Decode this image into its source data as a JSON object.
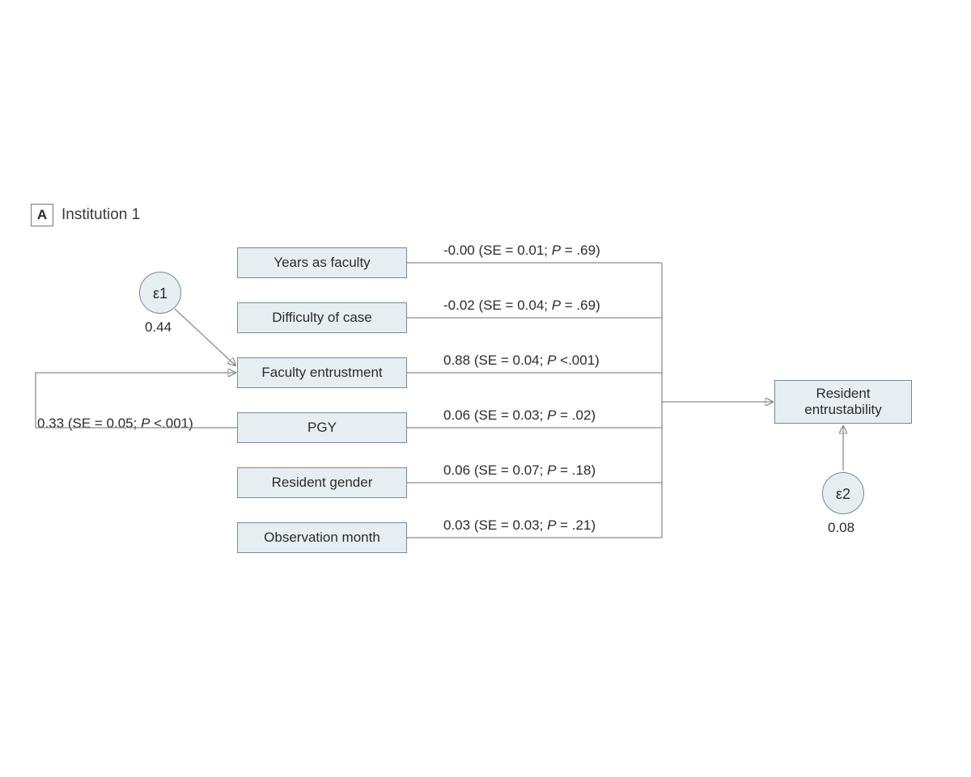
{
  "panel": {
    "letter": "A",
    "title": "Institution 1"
  },
  "predictors": {
    "years_faculty": {
      "label": "Years as faculty",
      "coef": "-0.00",
      "se": "0.01",
      "p": ".69"
    },
    "difficulty": {
      "label": "Difficulty of case",
      "coef": "-0.02",
      "se": "0.04",
      "p": ".69"
    },
    "faculty_entrust": {
      "label": "Faculty entrustment",
      "coef": "0.88",
      "se": "0.04",
      "p": "<.001"
    },
    "pgy": {
      "label": "PGY",
      "coef": "0.06",
      "se": "0.03",
      "p": ".02"
    },
    "resident_gender": {
      "label": "Resident gender",
      "coef": "0.06",
      "se": "0.07",
      "p": ".18"
    },
    "obs_month": {
      "label": "Observation month",
      "coef": "0.03",
      "se": "0.03",
      "p": ".21"
    }
  },
  "pgy_to_entrust": {
    "coef": "0.33",
    "se": "0.05",
    "p": "<.001"
  },
  "outcome": {
    "label_line1": "Resident",
    "label_line2": "entrustability"
  },
  "errors": {
    "e1": {
      "label": "ε1",
      "value": "0.44"
    },
    "e2": {
      "label": "ε2",
      "value": "0.08"
    }
  }
}
